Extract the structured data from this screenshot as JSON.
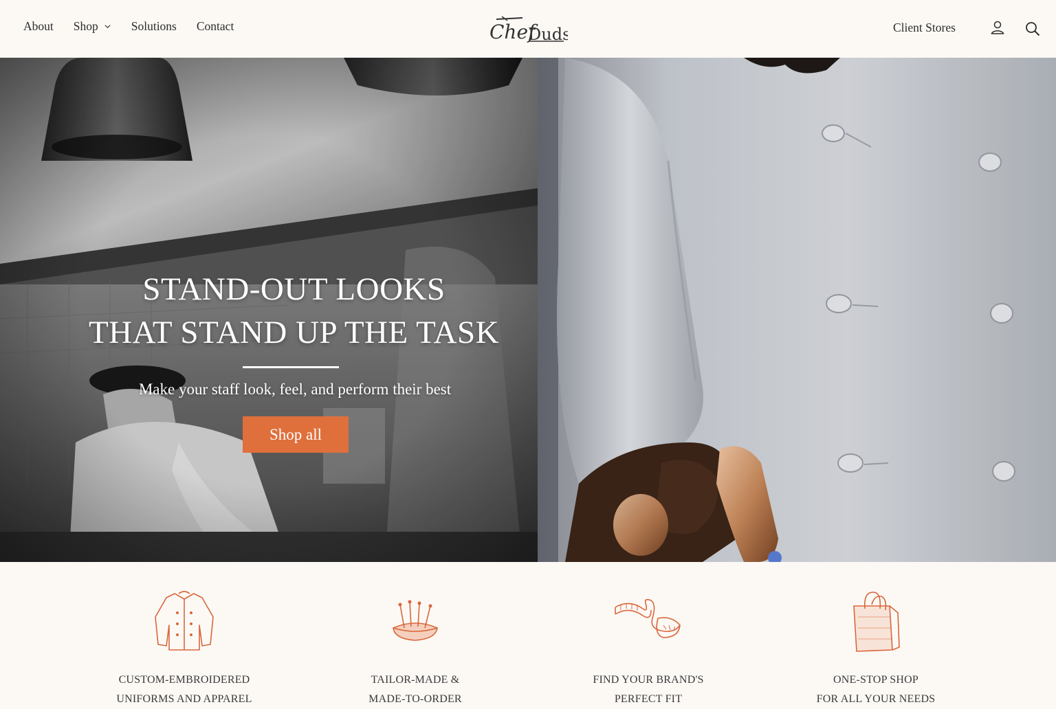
{
  "header": {
    "nav": [
      {
        "label": "About"
      },
      {
        "label": "Shop"
      },
      {
        "label": "Solutions"
      },
      {
        "label": "Contact"
      }
    ],
    "logo_text": "Chef Duds",
    "client_stores": "Client Stores",
    "icons": [
      "account-icon",
      "search-icon",
      "chevron-down-icon"
    ]
  },
  "hero": {
    "title_line1": "STAND-OUT LOOKS",
    "title_line2": "THAT STAND UP THE TASK",
    "subtitle": "Make your staff look, feel, and perform their best",
    "cta": "Shop all"
  },
  "features": [
    {
      "icon": "chef-jacket-icon",
      "line1": "CUSTOM-EMBROIDERED",
      "line2": "UNIFORMS AND APPAREL"
    },
    {
      "icon": "pincushion-icon",
      "line1": "TAILOR-MADE &",
      "line2": "MADE-TO-ORDER"
    },
    {
      "icon": "measuring-tape-icon",
      "line1": "FIND YOUR BRAND'S",
      "line2": "PERFECT FIT"
    },
    {
      "icon": "shopping-bag-icon",
      "line1": "ONE-STOP SHOP",
      "line2": "FOR ALL YOUR NEEDS"
    }
  ],
  "colors": {
    "accent": "#df6f3b",
    "page_bg": "#fcf9f5",
    "text": "#2c2c2c"
  }
}
